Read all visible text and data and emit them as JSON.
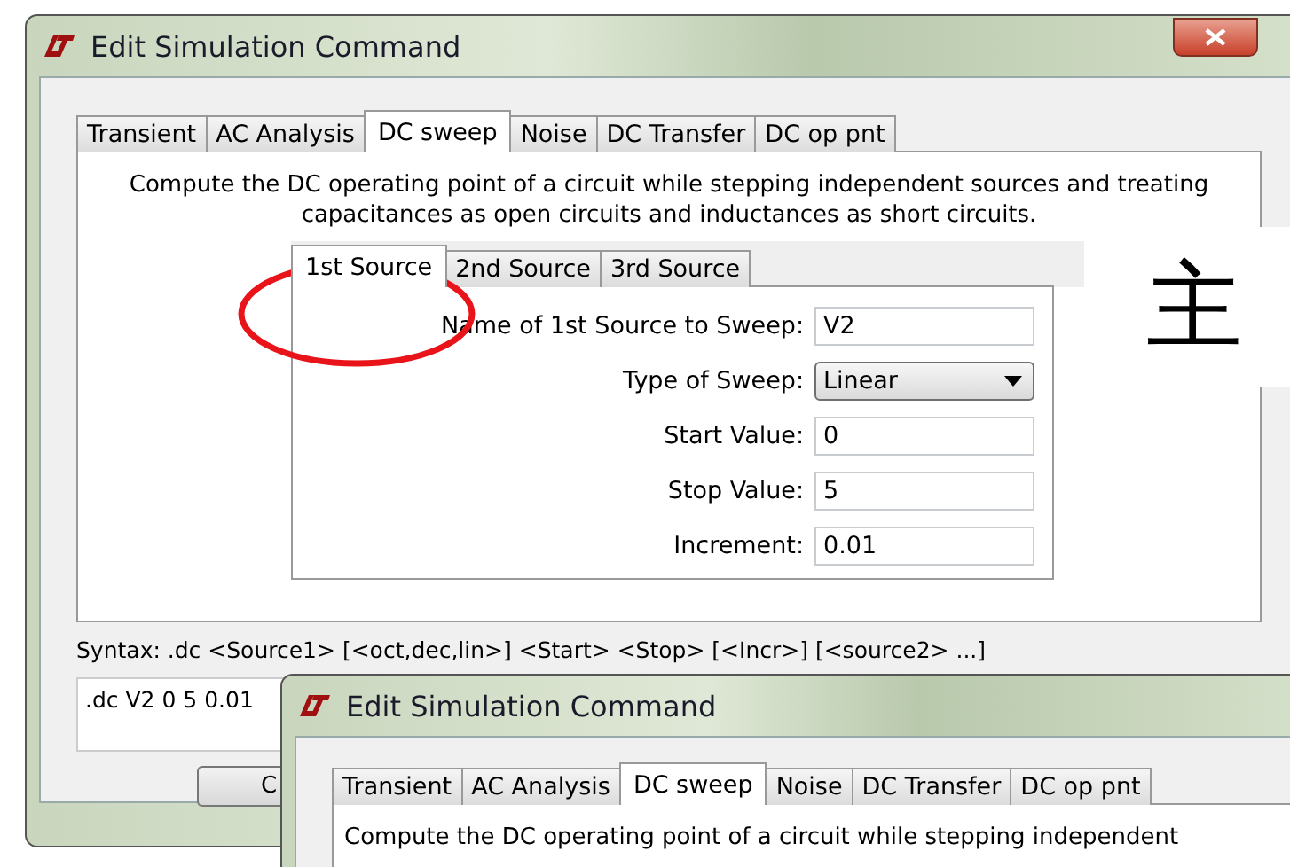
{
  "windows": [
    {
      "title": "Edit Simulation Command",
      "tabs": [
        {
          "label": "Transient",
          "selected": false
        },
        {
          "label": "AC Analysis",
          "selected": false
        },
        {
          "label": "DC sweep",
          "selected": true
        },
        {
          "label": "Noise",
          "selected": false
        },
        {
          "label": "DC Transfer",
          "selected": false
        },
        {
          "label": "DC op pnt",
          "selected": false
        }
      ],
      "description": "Compute the DC operating point of a circuit while stepping independent sources and treating capacitances as open circuits and inductances as short circuits.",
      "source_tabs": [
        {
          "label": "1st Source",
          "selected": true
        },
        {
          "label": "2nd Source",
          "selected": false
        },
        {
          "label": "3rd Source",
          "selected": false
        }
      ],
      "fields": [
        {
          "kind": "text",
          "label": "Name of 1st Source to Sweep:",
          "value": "V2"
        },
        {
          "kind": "dropdown",
          "label": "Type of Sweep:",
          "value": "Linear"
        },
        {
          "kind": "text",
          "label": "Start Value:",
          "value": "0"
        },
        {
          "kind": "text",
          "label": "Stop Value:",
          "value": "5"
        },
        {
          "kind": "text",
          "label": "Increment:",
          "value": "0.01"
        }
      ],
      "syntax": "Syntax:  .dc <Source1> [<oct,dec,lin>] <Start> <Stop> [<Incr>] [<source2> ...]",
      "command": ".dc V2 0 5 0.01",
      "buttons": [
        "C"
      ]
    },
    {
      "title": "Edit Simulation Command",
      "tabs": [
        {
          "label": "Transient",
          "selected": false
        },
        {
          "label": "AC Analysis",
          "selected": false
        },
        {
          "label": "DC sweep",
          "selected": true
        },
        {
          "label": "Noise",
          "selected": false
        },
        {
          "label": "DC Transfer",
          "selected": false
        },
        {
          "label": "DC op pnt",
          "selected": false
        }
      ],
      "description": "Compute the DC operating point of a circuit while stepping independent"
    }
  ],
  "annotation": {
    "text": "主"
  }
}
